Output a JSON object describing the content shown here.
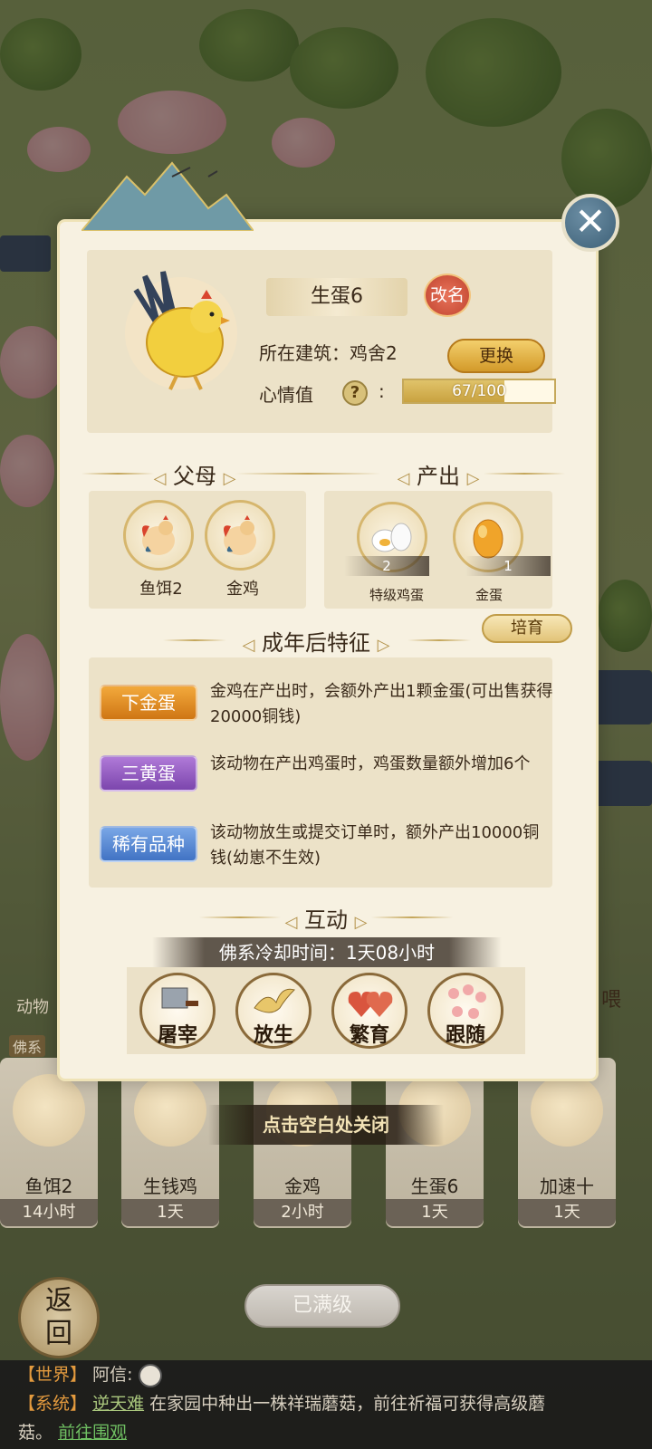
{
  "scene": {
    "behind_tab_label": "动物",
    "behind_filter_label": "佛系",
    "behind_side_label": "喂"
  },
  "animal_list": [
    {
      "name": "鱼饵2",
      "time": "14小时"
    },
    {
      "name": "生钱鸡",
      "time": "1天"
    },
    {
      "name": "金鸡",
      "time": "2小时"
    },
    {
      "name": "生蛋6",
      "time": "1天"
    },
    {
      "name": "加速十",
      "time": "1天"
    }
  ],
  "max_level_label": "已满级",
  "back_label": "返回",
  "tap_close_hint": "点击空白处关闭",
  "chat": {
    "line1": {
      "tag": "【世界】",
      "name": "阿信:"
    },
    "line2": {
      "tag": "【系统】",
      "name": "逆天难",
      "text": "在家园中种出一株祥瑞蘑菇，前往祈福可获得高级蘑",
      "continued": "菇。",
      "link": "前往围观"
    }
  },
  "modal": {
    "close_icon": "close-icon",
    "animal": {
      "name": "生蛋6",
      "rename_label": "改名",
      "building_label": "所在建筑：",
      "building_value": "鸡舍2",
      "change_label": "更换",
      "mood_label": "心情值",
      "mood_colon": ":",
      "mood_text": "67/100",
      "mood_fraction": 0.67
    },
    "parents": {
      "title": "父母",
      "items": [
        {
          "name": "鱼饵2"
        },
        {
          "name": "金鸡"
        }
      ]
    },
    "output": {
      "title": "产出",
      "items": [
        {
          "name": "特级鸡蛋",
          "count": "2"
        },
        {
          "name": "金蛋",
          "count": "1"
        }
      ]
    },
    "traits": {
      "title": "成年后特征",
      "train_label": "培育",
      "items": [
        {
          "badge": "下金蛋",
          "desc": "金鸡在产出时，会额外产出1颗金蛋(可出售获得20000铜钱)"
        },
        {
          "badge": "三黄蛋",
          "desc": "该动物在产出鸡蛋时，鸡蛋数量额外增加6个"
        },
        {
          "badge": "稀有品种",
          "desc": "该动物放生或提交订单时，额外产出10000铜钱(幼崽不生效)"
        }
      ]
    },
    "interact": {
      "title": "互动",
      "cooldown": "佛系冷却时间：1天08小时",
      "actions": [
        {
          "label": "屠宰",
          "icon": "cleaver-icon"
        },
        {
          "label": "放生",
          "icon": "bird-icon"
        },
        {
          "label": "繁育",
          "icon": "hearts-icon"
        },
        {
          "label": "跟随",
          "icon": "paw-icon"
        }
      ]
    }
  },
  "colors": {
    "accent_gold": "#d39a2a",
    "panel_bg": "#f7f1e1",
    "close_blue": "#3d6077"
  }
}
